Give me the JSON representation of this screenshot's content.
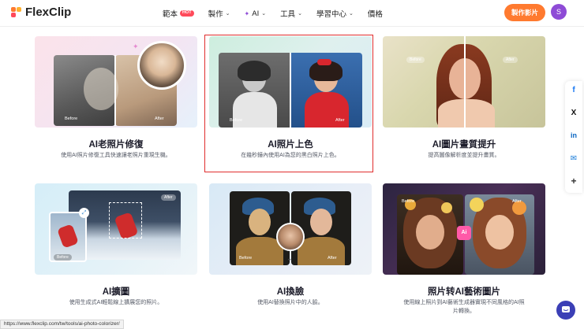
{
  "header": {
    "logo_text": "FlexClip",
    "nav": [
      {
        "label": "範本",
        "badge": "HOT"
      },
      {
        "label": "製作",
        "chevron": true
      },
      {
        "label": "AI",
        "chevron": true,
        "spark": true
      },
      {
        "label": "工具",
        "chevron": true
      },
      {
        "label": "學習中心",
        "chevron": true
      },
      {
        "label": "價格"
      }
    ],
    "cta_label": "製作影片",
    "avatar_letter": "S"
  },
  "cards": [
    {
      "title": "AI老照片修復",
      "desc": "使用AI照片修復工具快速讓老照片重現生機。",
      "before": "Before",
      "after": "After"
    },
    {
      "title": "AI照片上色",
      "desc": "在幾秒鐘內使用AI為您的黑白照片上色。",
      "before": "Before",
      "after": "After"
    },
    {
      "title": "AI圖片畫質提升",
      "desc": "提高圖像解析度並提升畫質。",
      "before": "Before",
      "after": "After"
    },
    {
      "title": "AI擴圖",
      "desc": "使用生成式AI輕鬆線上擴展您的照片。",
      "before": "Before",
      "after": "After"
    },
    {
      "title": "AI換臉",
      "desc": "使用AI替換照片中的人臉。",
      "before": "Before",
      "after": "After"
    },
    {
      "title": "照片转AI藝術圖片",
      "desc_line1": "使用線上照片到AI藝術生成器實現不同風格的AI照",
      "desc_line2": "片轉換。",
      "before": "Before",
      "after": "After",
      "ai_badge": "Ai"
    }
  ],
  "social": [
    "f",
    "X",
    "in",
    "✉",
    "+"
  ],
  "status_url": "https://www.flexclip.com/tw/tools/ai-photo-colorizer/",
  "colors": {
    "accent": "#ff7a2f",
    "highlight": "#e02d2d",
    "avatar": "#8e4bd6",
    "chat": "#3b3fb6"
  }
}
